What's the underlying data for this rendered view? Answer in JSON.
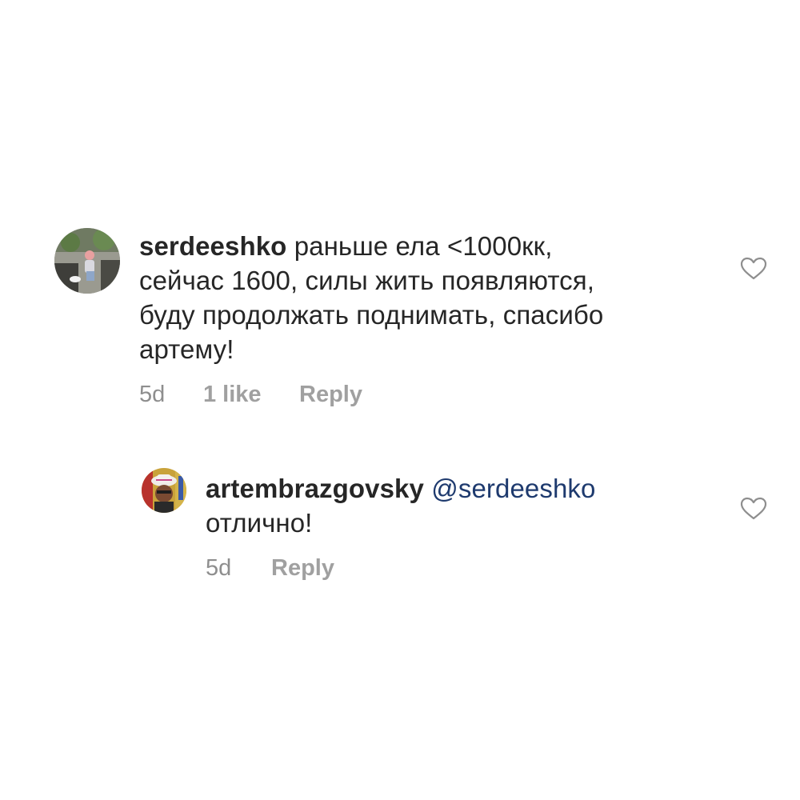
{
  "comments": [
    {
      "username": "serdeeshko",
      "text_line1": " раньше ела <1000кк,",
      "text_line2": "сейчас 1600, силы жить появляются,",
      "text_line3": "буду продолжать поднимать, спасибо",
      "text_line4": "артему!",
      "time": "5d",
      "likes": "1 like",
      "reply_label": "Reply",
      "heart_icon": "heart-outline-icon"
    },
    {
      "username": "artembrazgovsky",
      "mention": "@serdeeshko",
      "text_line2": "отлично!",
      "time": "5d",
      "reply_label": "Reply",
      "heart_icon": "heart-outline-icon"
    }
  ],
  "colors": {
    "text": "#262626",
    "meta": "#8e8e8e",
    "mention": "#1e3a6e",
    "background": "#ffffff"
  }
}
